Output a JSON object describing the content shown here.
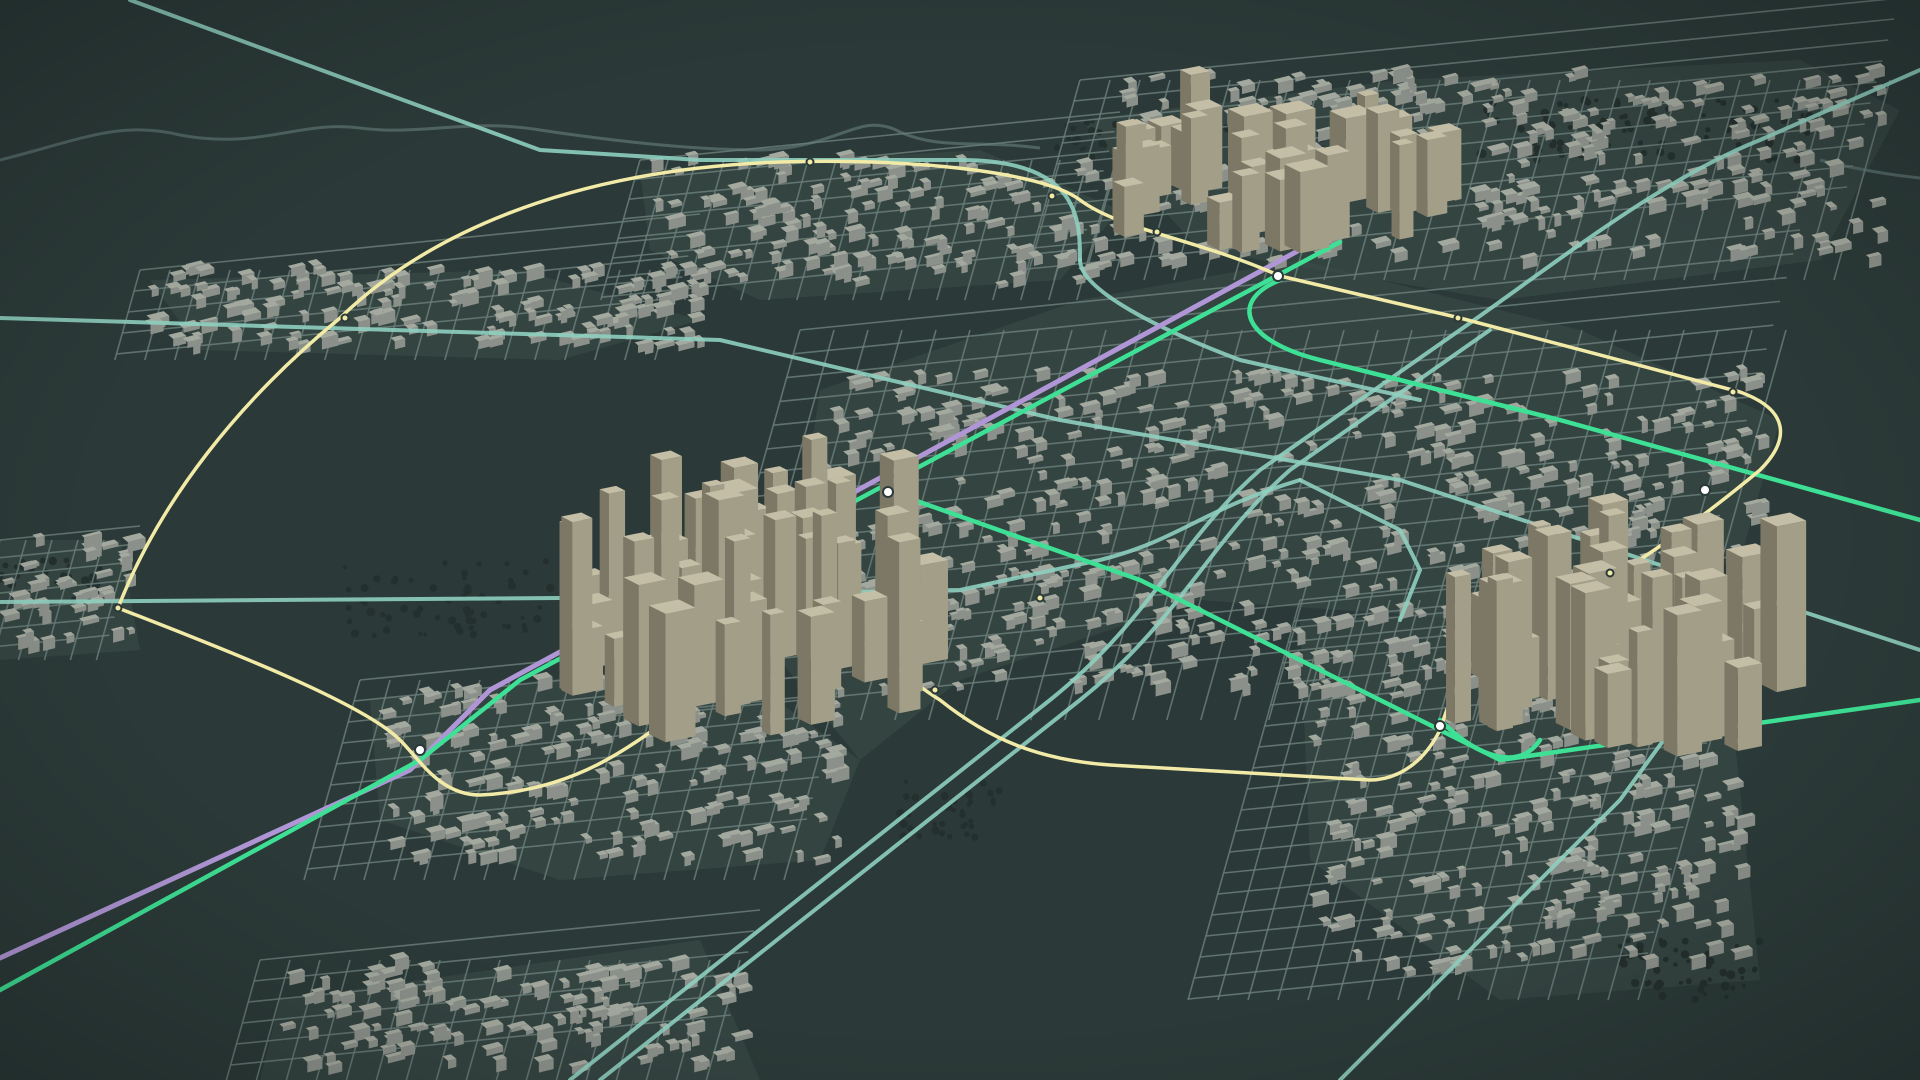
{
  "map": {
    "style": "3d isometric city transit map",
    "colors": {
      "background": "#2b3a38",
      "terrain_dark": "#2f3e3c",
      "block_fill": "#3d4c49",
      "building_low": "#8b918a",
      "building_low_top": "#a4a99f",
      "tower": "#a39e88",
      "tower_top": "#c4bea6",
      "tower_shade": "#7d7866",
      "street": "#6a7c78",
      "river": "#4f6461",
      "trees": "#24302e",
      "highway": "#8ecfbf",
      "loop_line": "#f2eaa7",
      "green_line": "#3ee095",
      "purple_line": "#b096d6",
      "station_fill": "#ffffff"
    },
    "districts": [
      {
        "name": "northeast-downtown",
        "role": "high-rise cluster"
      },
      {
        "name": "west-downtown",
        "role": "high-rise cluster"
      },
      {
        "name": "southeast-downtown",
        "role": "high-rise cluster"
      },
      {
        "name": "central-grid",
        "role": "low-rise grid"
      },
      {
        "name": "north-suburbs",
        "role": "low-rise"
      },
      {
        "name": "west-suburbs",
        "role": "low-rise"
      },
      {
        "name": "south-suburbs",
        "role": "low-rise"
      }
    ],
    "transit_lines": [
      {
        "id": "loop",
        "kind": "rail loop",
        "color": "#f2eaa7"
      },
      {
        "id": "green-diagonal",
        "kind": "rail",
        "color": "#3ee095"
      },
      {
        "id": "green-east-west",
        "kind": "rail",
        "color": "#3ee095"
      },
      {
        "id": "purple",
        "kind": "rail",
        "color": "#b096d6"
      },
      {
        "id": "highways",
        "kind": "highway",
        "color": "#8ecfbf"
      }
    ],
    "station_count": 18
  }
}
